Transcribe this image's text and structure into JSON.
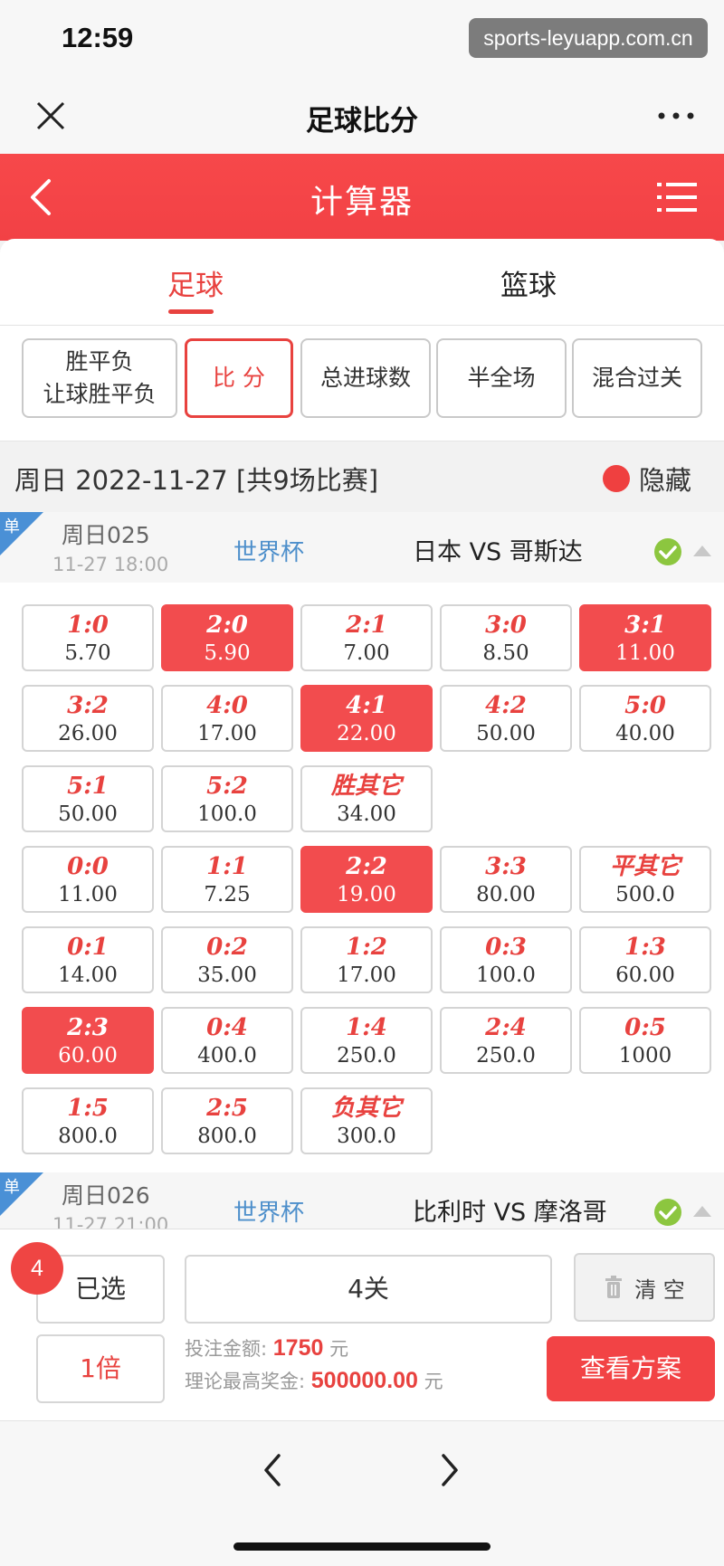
{
  "status": {
    "time": "12:59",
    "watermark": "sports-leyuapp.com.cn"
  },
  "nav": {
    "title": "足球比分"
  },
  "header": {
    "title": "计算器"
  },
  "tabs": [
    {
      "label": "足球",
      "active": true
    },
    {
      "label": "篮球",
      "active": false
    }
  ],
  "play_types": [
    {
      "line1": "胜平负",
      "line2": "让球胜平负",
      "active": false
    },
    {
      "line1": "比 分",
      "line2": "",
      "active": true
    },
    {
      "line1": "总进球数",
      "line2": "",
      "active": false
    },
    {
      "line1": "半全场",
      "line2": "",
      "active": false
    },
    {
      "line1": "混合过关",
      "line2": "",
      "active": false
    }
  ],
  "date_row": {
    "text": "周日 2022-11-27 [共9场比赛]",
    "hide_label": "隐藏"
  },
  "matches": [
    {
      "tag": "单",
      "number": "周日025",
      "time": "11-27 18:00",
      "league": "世界杯",
      "teams": "日本 VS 哥斯达"
    },
    {
      "tag": "单",
      "number": "周日026",
      "time": "11-27 21:00",
      "league": "世界杯",
      "teams": "比利时 VS 摩洛哥"
    }
  ],
  "odds_rows": [
    [
      {
        "score": "1:0",
        "odd": "5.70",
        "selected": false
      },
      {
        "score": "2:0",
        "odd": "5.90",
        "selected": true
      },
      {
        "score": "2:1",
        "odd": "7.00",
        "selected": false
      },
      {
        "score": "3:0",
        "odd": "8.50",
        "selected": false
      },
      {
        "score": "3:1",
        "odd": "11.00",
        "selected": true
      }
    ],
    [
      {
        "score": "3:2",
        "odd": "26.00",
        "selected": false
      },
      {
        "score": "4:0",
        "odd": "17.00",
        "selected": false
      },
      {
        "score": "4:1",
        "odd": "22.00",
        "selected": true
      },
      {
        "score": "4:2",
        "odd": "50.00",
        "selected": false
      },
      {
        "score": "5:0",
        "odd": "40.00",
        "selected": false
      }
    ],
    [
      {
        "score": "5:1",
        "odd": "50.00",
        "selected": false
      },
      {
        "score": "5:2",
        "odd": "100.0",
        "selected": false
      },
      {
        "score": "胜其它",
        "odd": "34.00",
        "selected": false
      }
    ],
    [
      {
        "score": "0:0",
        "odd": "11.00",
        "selected": false
      },
      {
        "score": "1:1",
        "odd": "7.25",
        "selected": false
      },
      {
        "score": "2:2",
        "odd": "19.00",
        "selected": true
      },
      {
        "score": "3:3",
        "odd": "80.00",
        "selected": false
      },
      {
        "score": "平其它",
        "odd": "500.0",
        "selected": false
      }
    ],
    [
      {
        "score": "0:1",
        "odd": "14.00",
        "selected": false
      },
      {
        "score": "0:2",
        "odd": "35.00",
        "selected": false
      },
      {
        "score": "1:2",
        "odd": "17.00",
        "selected": false
      },
      {
        "score": "0:3",
        "odd": "100.0",
        "selected": false
      },
      {
        "score": "1:3",
        "odd": "60.00",
        "selected": false
      }
    ],
    [
      {
        "score": "2:3",
        "odd": "60.00",
        "selected": true
      },
      {
        "score": "0:4",
        "odd": "400.0",
        "selected": false
      },
      {
        "score": "1:4",
        "odd": "250.0",
        "selected": false
      },
      {
        "score": "2:4",
        "odd": "250.0",
        "selected": false
      },
      {
        "score": "0:5",
        "odd": "1000",
        "selected": false
      }
    ],
    [
      {
        "score": "1:5",
        "odd": "800.0",
        "selected": false
      },
      {
        "score": "2:5",
        "odd": "800.0",
        "selected": false
      },
      {
        "score": "负其它",
        "odd": "300.0",
        "selected": false
      }
    ]
  ],
  "bottom": {
    "badge_count": "4",
    "selected_label": "已选",
    "pass_label": "4关",
    "clear_label": "清 空",
    "multiple_label": "1倍",
    "bet_amount_label": "投注金额:",
    "bet_amount_value": "1750",
    "max_prize_label": "理论最高奖金:",
    "max_prize_value": "500000.00",
    "currency_unit": "元",
    "view_plan_label": "查看方案"
  },
  "colors": {
    "accent": "#f24345",
    "league_blue": "#4d8fcb",
    "check_green": "#8cc63f"
  }
}
